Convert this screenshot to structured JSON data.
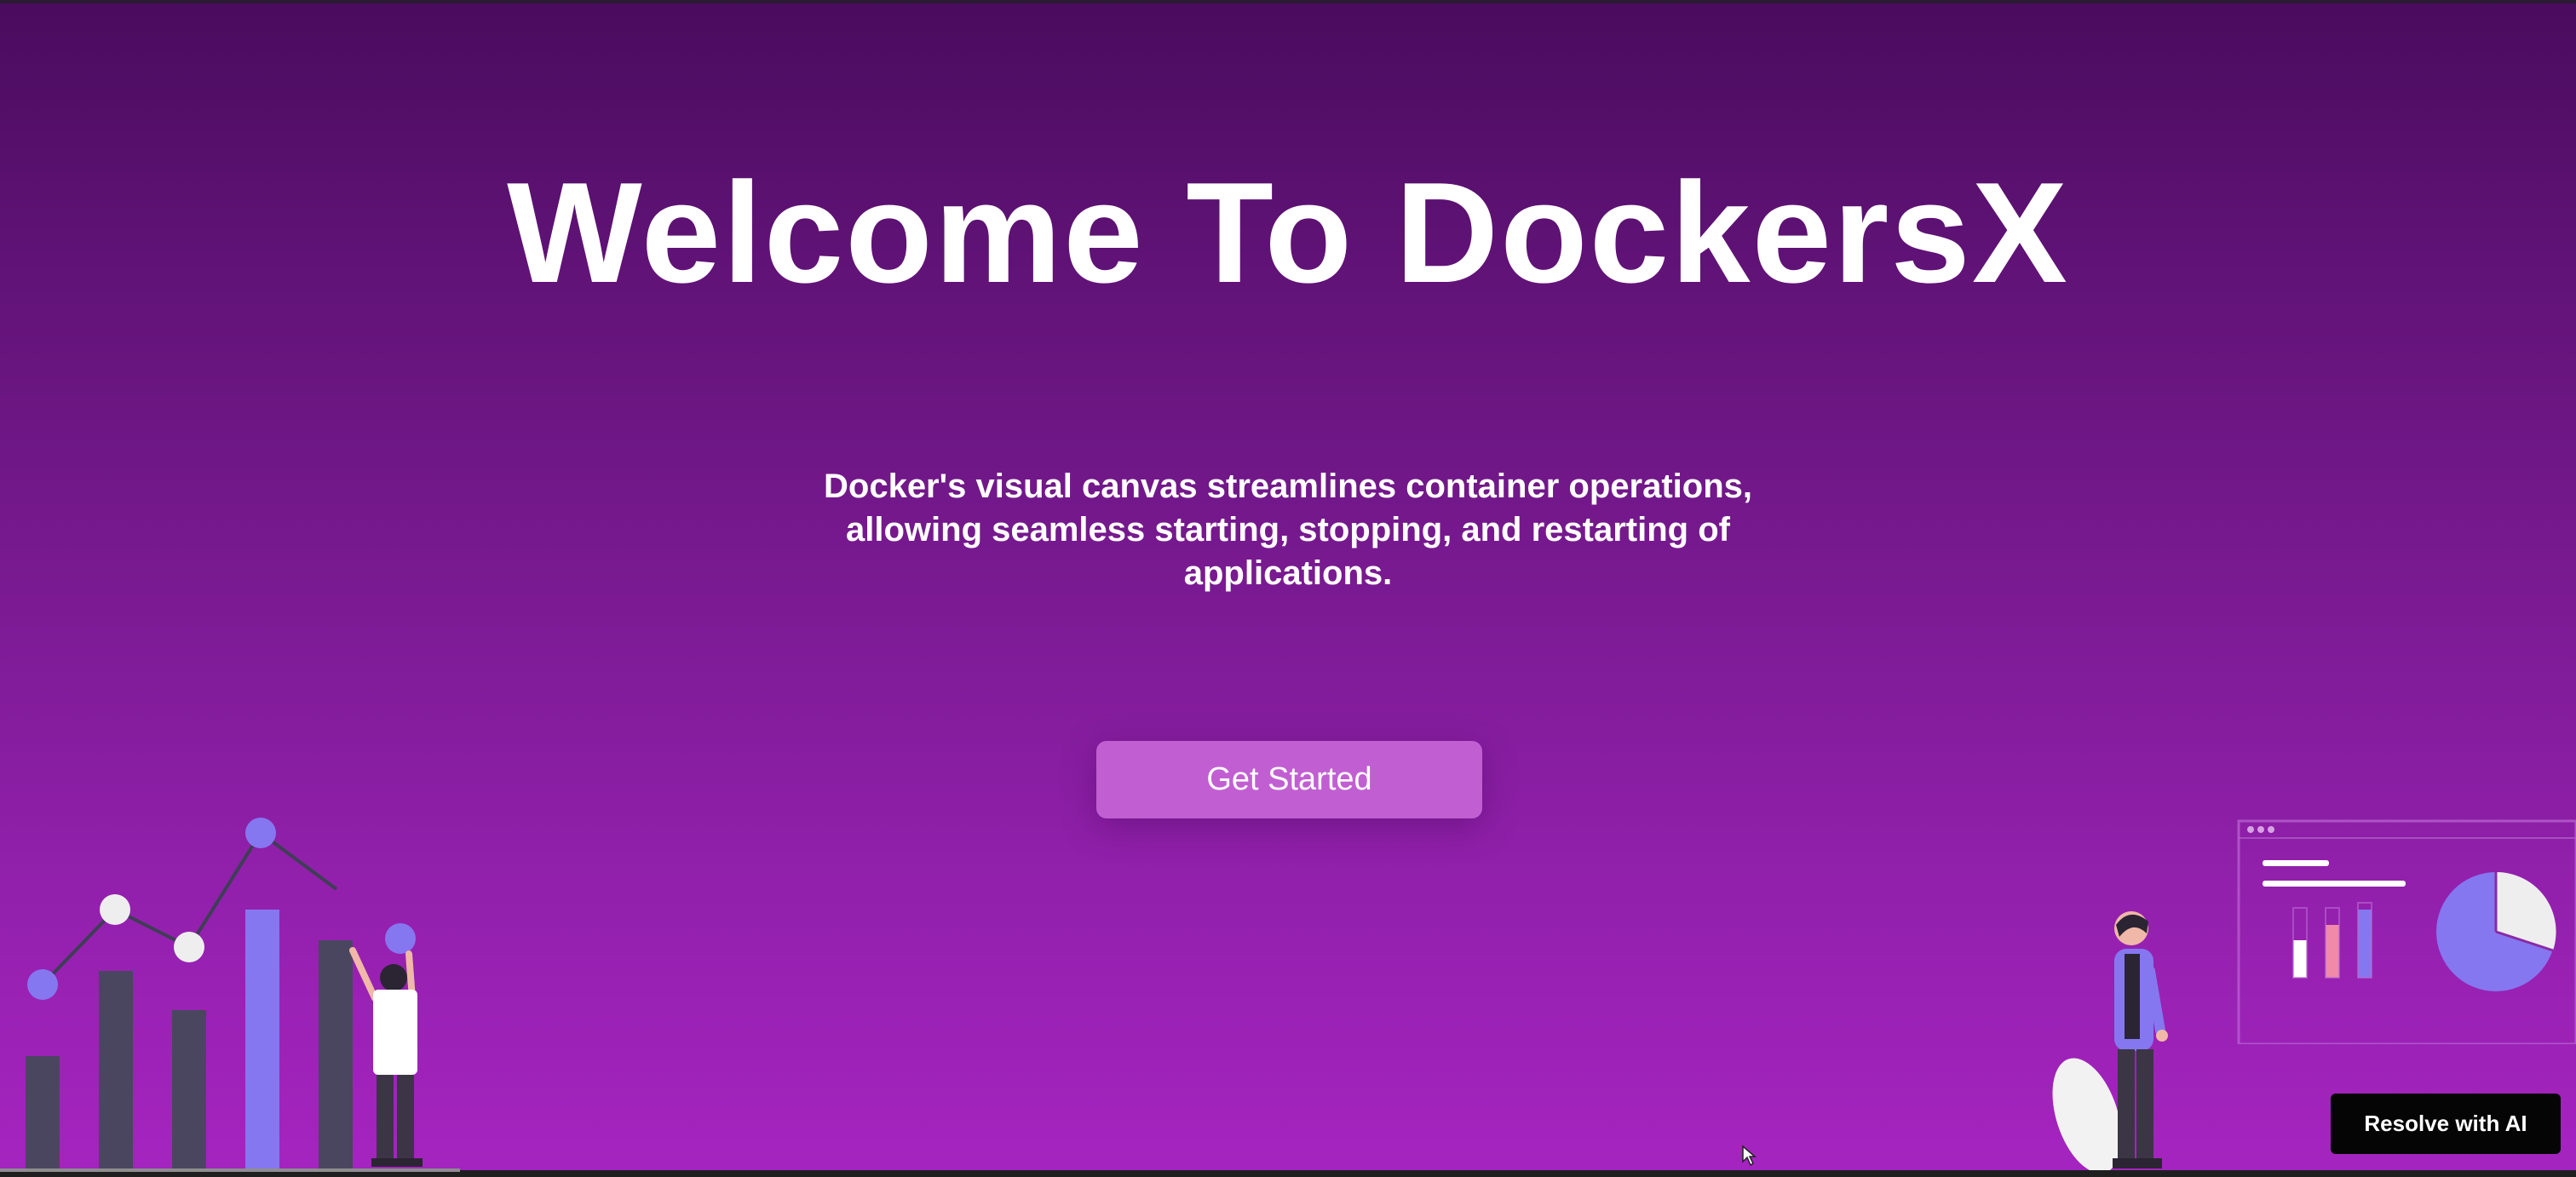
{
  "hero": {
    "title": "Welcome To DockersX",
    "description": "Docker's visual canvas streamlines container operations, allowing seamless starting, stopping, and restarting of applications.",
    "cta_label": "Get Started"
  },
  "overlay": {
    "resolve_label": "Resolve with AI"
  },
  "illustrations": {
    "left": "chart-with-person-illustration",
    "right_person": "standing-person-illustration",
    "right_dashboard": "dashboard-panel-illustration"
  },
  "colors": {
    "background_top": "#4a0c5e",
    "background_bottom": "#a524c0",
    "button": "#c15fd2",
    "bar_accent": "#8577f0",
    "bar_dark": "#4b4660"
  }
}
